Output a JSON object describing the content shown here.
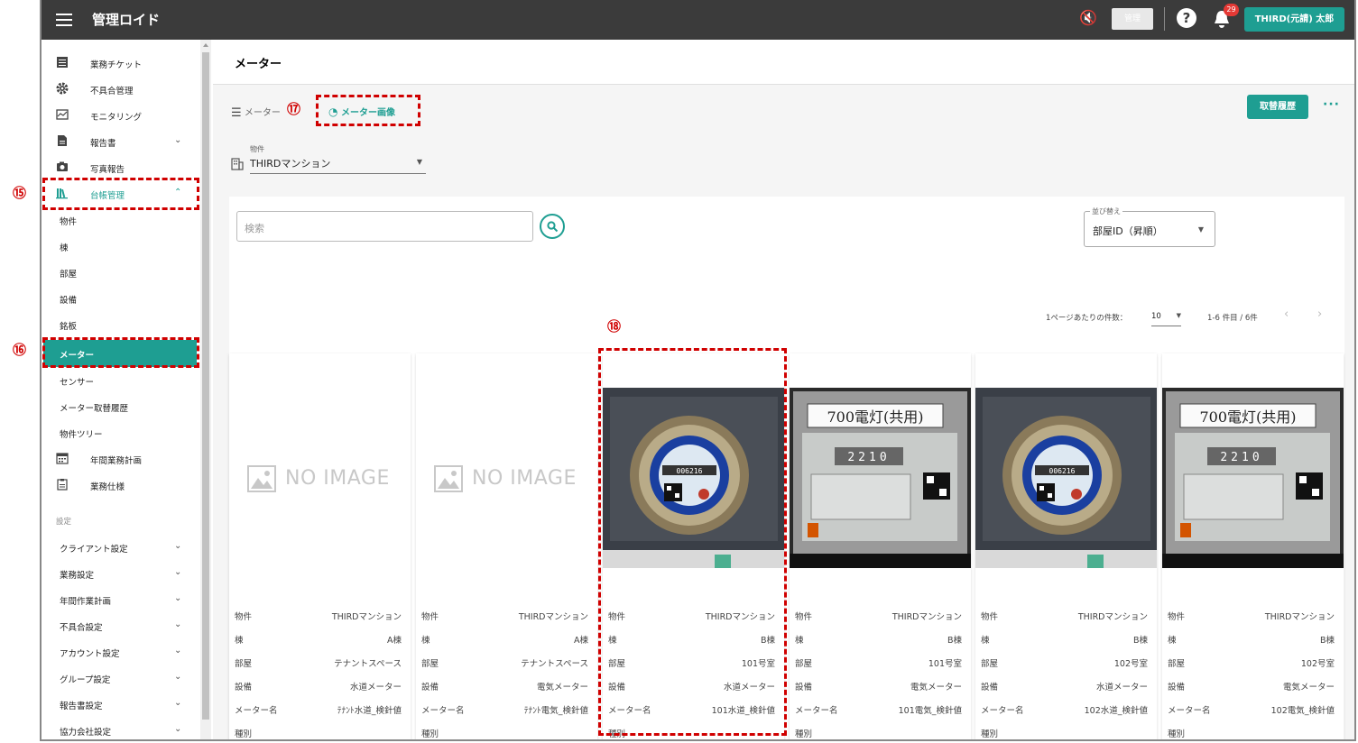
{
  "app": {
    "title": "管理ロイド",
    "admin_chip": "管理",
    "notif_count": "29",
    "user": "THIRD(元請) 太郎"
  },
  "sidebar": {
    "items": [
      {
        "label": "業務チケット",
        "icon": "list-icon"
      },
      {
        "label": "不具合管理",
        "icon": "gear-icon"
      },
      {
        "label": "モニタリング",
        "icon": "chart-icon"
      },
      {
        "label": "報告書",
        "icon": "document-icon"
      },
      {
        "label": "写真報告",
        "icon": "camera-icon"
      },
      {
        "label": "台帳管理",
        "icon": "books-icon"
      }
    ],
    "sub_items": [
      "物件",
      "棟",
      "部屋",
      "設備",
      "銘板",
      "メーター",
      "センサー",
      "メーター取替履歴",
      "物件ツリー"
    ],
    "items2": [
      {
        "label": "年間業務計画",
        "icon": "calendar-icon"
      },
      {
        "label": "業務仕様",
        "icon": "clipboard-icon"
      }
    ],
    "settings_header": "設定",
    "settings": [
      "クライアント設定",
      "業務設定",
      "年間作業計画",
      "不具合設定",
      "アカウント設定",
      "グループ設定",
      "報告書設定",
      "協力会社設定"
    ]
  },
  "page": {
    "title": "メーター",
    "tab_list": "メーター",
    "tab_image": "メーター画像",
    "history_button": "取替履歴",
    "property_label": "物件",
    "property_value": "THIRDマンション",
    "search_placeholder": "検索",
    "sort_label": "並び替え",
    "sort_value": "部屋ID（昇順）",
    "per_page_label": "1ページあたりの件数：",
    "per_page_value": "10",
    "range": "1-6 件目 / 6件"
  },
  "annotations": {
    "n15": "⑮",
    "n16": "⑯",
    "n17": "⑰",
    "n18": "⑱"
  },
  "no_image_text": "NO IMAGE",
  "field_labels": {
    "property": "物件",
    "building": "棟",
    "room": "部屋",
    "equipment": "設備",
    "meter_name": "メーター名",
    "type": "種別"
  },
  "meters": [
    {
      "image": "none",
      "property": "THIRDマンション",
      "building": "A棟",
      "room": "テナントスペース",
      "equipment": "水道メーター",
      "meter_name": "ﾃﾅﾝﾄ水道_検針値"
    },
    {
      "image": "none",
      "property": "THIRDマンション",
      "building": "A棟",
      "room": "テナントスペース",
      "equipment": "電気メーター",
      "meter_name": "ﾃﾅﾝﾄ電気_検針値"
    },
    {
      "image": "water",
      "property": "THIRDマンション",
      "building": "B棟",
      "room": "101号室",
      "equipment": "水道メーター",
      "meter_name": "101水道_検針値"
    },
    {
      "image": "electric",
      "property": "THIRDマンション",
      "building": "B棟",
      "room": "101号室",
      "equipment": "電気メーター",
      "meter_name": "101電気_検針値"
    },
    {
      "image": "water",
      "property": "THIRDマンション",
      "building": "B棟",
      "room": "102号室",
      "equipment": "水道メーター",
      "meter_name": "102水道_検針値"
    },
    {
      "image": "electric",
      "property": "THIRDマンション",
      "building": "B棟",
      "room": "102号室",
      "equipment": "電気メーター",
      "meter_name": "102電気_検針値"
    }
  ],
  "photo_text": {
    "electric_sign": "700電灯(共用)",
    "electric_reading": "2210",
    "water_reading": "006216"
  },
  "colors": {
    "appbar": "#3b3b3b",
    "accent": "#1e9e92",
    "annotation": "#d00000",
    "badge": "#e53935"
  }
}
